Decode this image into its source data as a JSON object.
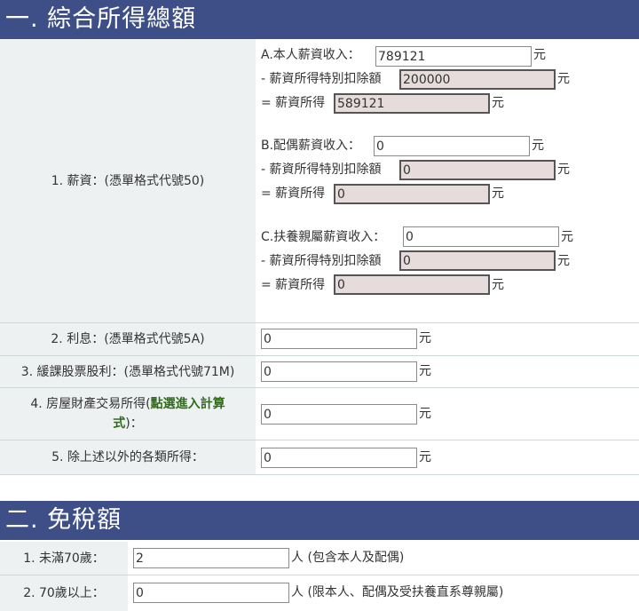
{
  "section1": {
    "title": "一. 綜合所得總額",
    "salary": {
      "label": "1. 薪資：(憑單格式代號50)",
      "a_income_label": "A.本人薪資收入：",
      "a_income_value": "789121",
      "a_deduction_label": "- 薪資所得特別扣除額",
      "a_deduction_value": "200000",
      "a_net_label": "= 薪資所得",
      "a_net_value": "589121",
      "b_income_label": "B.配偶薪資收入：",
      "b_income_value": "0",
      "b_deduction_label": "- 薪資所得特別扣除額",
      "b_deduction_value": "0",
      "b_net_label": "= 薪資所得",
      "b_net_value": "0",
      "c_income_label": "C.扶養親屬薪資收入：",
      "c_income_value": "0",
      "c_deduction_label": "- 薪資所得特別扣除額",
      "c_deduction_value": "0",
      "c_net_label": "= 薪資所得",
      "c_net_value": "0",
      "unit": "元"
    },
    "interest": {
      "label": "2. 利息：(憑單格式代號5A)",
      "value": "0",
      "unit": "元"
    },
    "dividend": {
      "label": "3. 緩課股票股利：(憑單格式代號71M)",
      "value": "0",
      "unit": "元"
    },
    "property": {
      "label_prefix": "4. 房屋財產交易所得(",
      "link": "點選進入計算式",
      "label_suffix": ")：",
      "value": "0",
      "unit": "元"
    },
    "other": {
      "label": "5. 除上述以外的各類所得：",
      "value": "0",
      "unit": "元"
    }
  },
  "section2": {
    "title": "二. 免稅額",
    "under70": {
      "label": "1. 未滿70歲：",
      "value": "2",
      "unit": "人 (包含本人及配偶)"
    },
    "over70": {
      "label": "2. 70歲以上：",
      "value": "0",
      "unit": "人 (限本人、配偶及受扶養直系尊親屬)"
    }
  },
  "colors": {
    "header_bg": "#3d4f86",
    "label_bg": "#eef1f1",
    "readonly_bg": "#e6dcdc",
    "link": "#2e6b1a"
  }
}
